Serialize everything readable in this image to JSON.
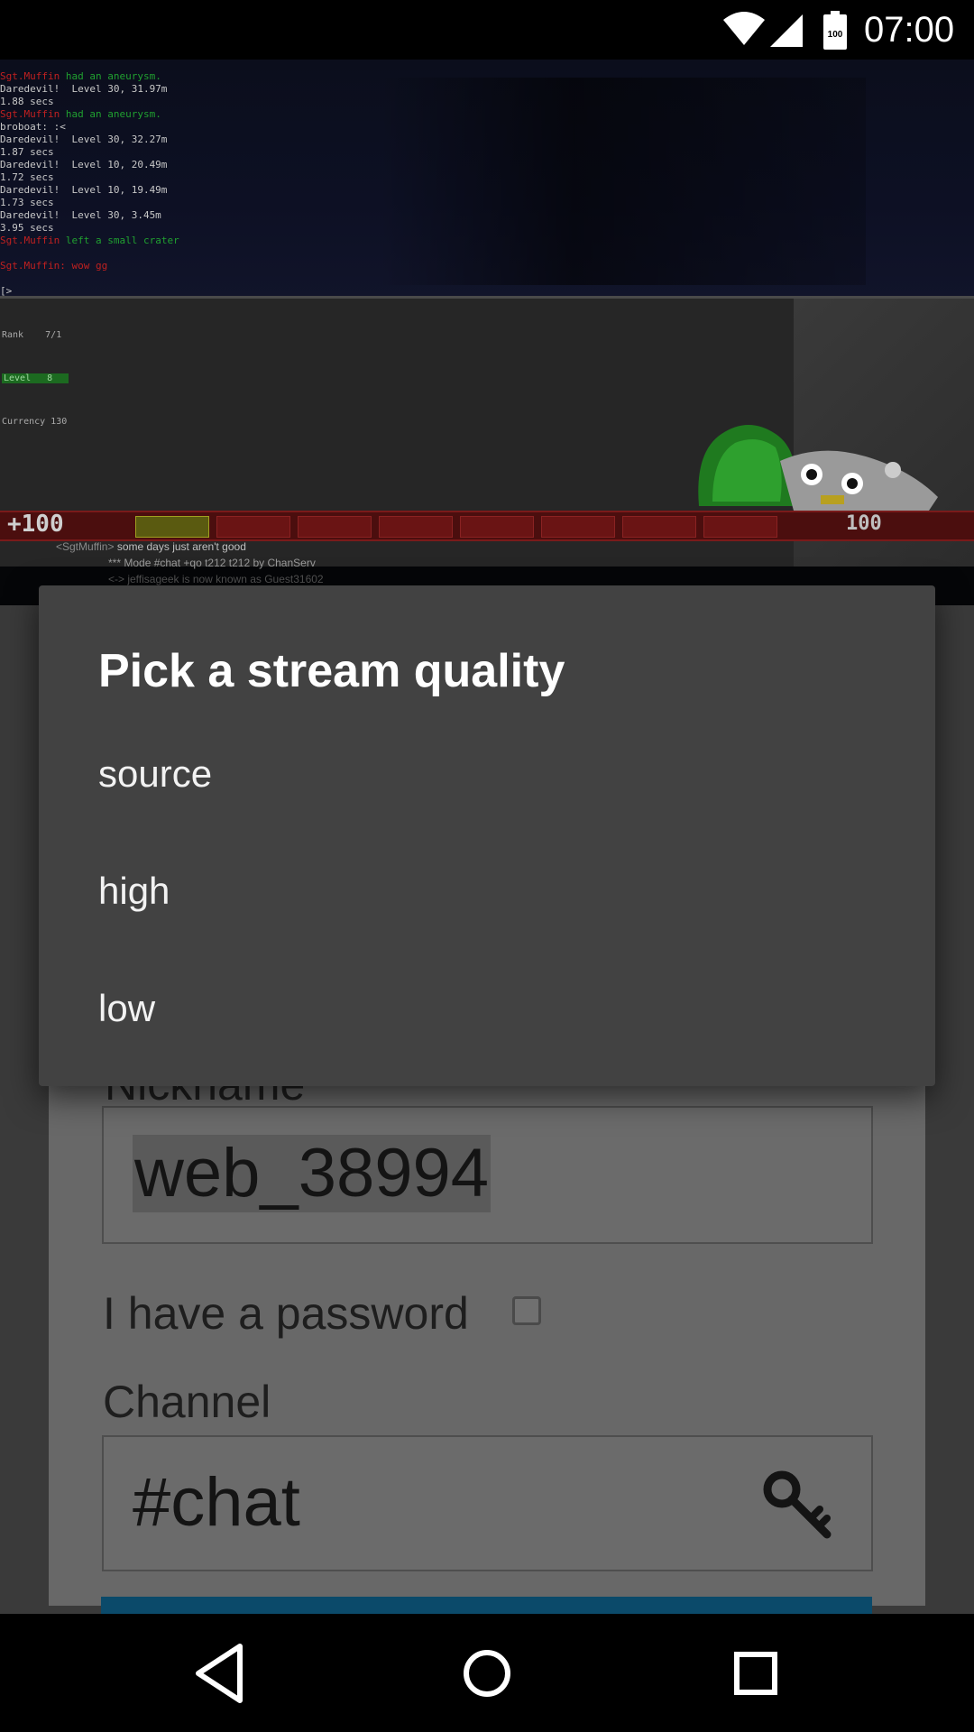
{
  "status_bar": {
    "time": "07:00",
    "battery_level": "100",
    "icons": [
      "wifi-icon",
      "cellular-signal-icon",
      "battery-icon"
    ]
  },
  "video": {
    "game_log": [
      {
        "text": "Sgt.Muffin had an aneurysm.",
        "color": "red-green"
      },
      {
        "text": "Daredevil!  Level 30, 31.97m",
        "color": "default"
      },
      {
        "text": "1.88 secs",
        "color": "default"
      },
      {
        "text": "Sgt.Muffin had an aneurysm.",
        "color": "red-green"
      },
      {
        "text": "broboat: :<",
        "color": "default"
      },
      {
        "text": "Daredevil!  Level 30, 32.27m",
        "color": "default"
      },
      {
        "text": "1.87 secs",
        "color": "default"
      },
      {
        "text": "Daredevil!  Level 10, 20.49m",
        "color": "default"
      },
      {
        "text": "1.72 secs",
        "color": "default"
      },
      {
        "text": "Daredevil!  Level 10, 19.49m",
        "color": "default"
      },
      {
        "text": "1.73 secs",
        "color": "default"
      },
      {
        "text": "Daredevil!  Level 30, 3.45m",
        "color": "default"
      },
      {
        "text": "3.95 secs",
        "color": "default"
      },
      {
        "text": "Sgt.Muffin left a small crater",
        "color": "red-green"
      },
      {
        "text": "",
        "color": "default"
      },
      {
        "text": "Sgt.Muffin: wow gg",
        "color": "red"
      },
      {
        "text": "",
        "color": "default"
      },
      {
        "text": "[>",
        "color": "default"
      }
    ],
    "player_stats": {
      "rank": "Rank    7/1",
      "level": "Level   8",
      "currency": "Currency 130"
    },
    "hud_health": "+100",
    "hud_ammo": "100",
    "irc_chat": [
      {
        "nick": "<SgtMuffin>",
        "text": " some days just aren't good"
      },
      {
        "nick": "",
        "text": "*** Mode #chat +qo t212 t212 by ChanServ"
      },
      {
        "nick": "",
        "text": "<-> jeffisageek is now known as Guest31602"
      }
    ]
  },
  "form": {
    "nickname_label": "Nickname",
    "nickname_value": "web_38994",
    "password_label": "I have a password",
    "password_checked": false,
    "channel_label": "Channel",
    "channel_value": "#chat",
    "channel_icon": "key-icon",
    "connect_color": "#0b4a6a"
  },
  "dialog": {
    "title": "Pick a stream quality",
    "options": [
      "source",
      "high",
      "low"
    ]
  },
  "nav_bar": {
    "buttons": [
      "back-icon",
      "home-icon",
      "recents-icon"
    ]
  },
  "colors": {
    "dialog_bg": "#424242",
    "scrim": "#3a3a3a",
    "status_bar_bg": "#000000"
  }
}
